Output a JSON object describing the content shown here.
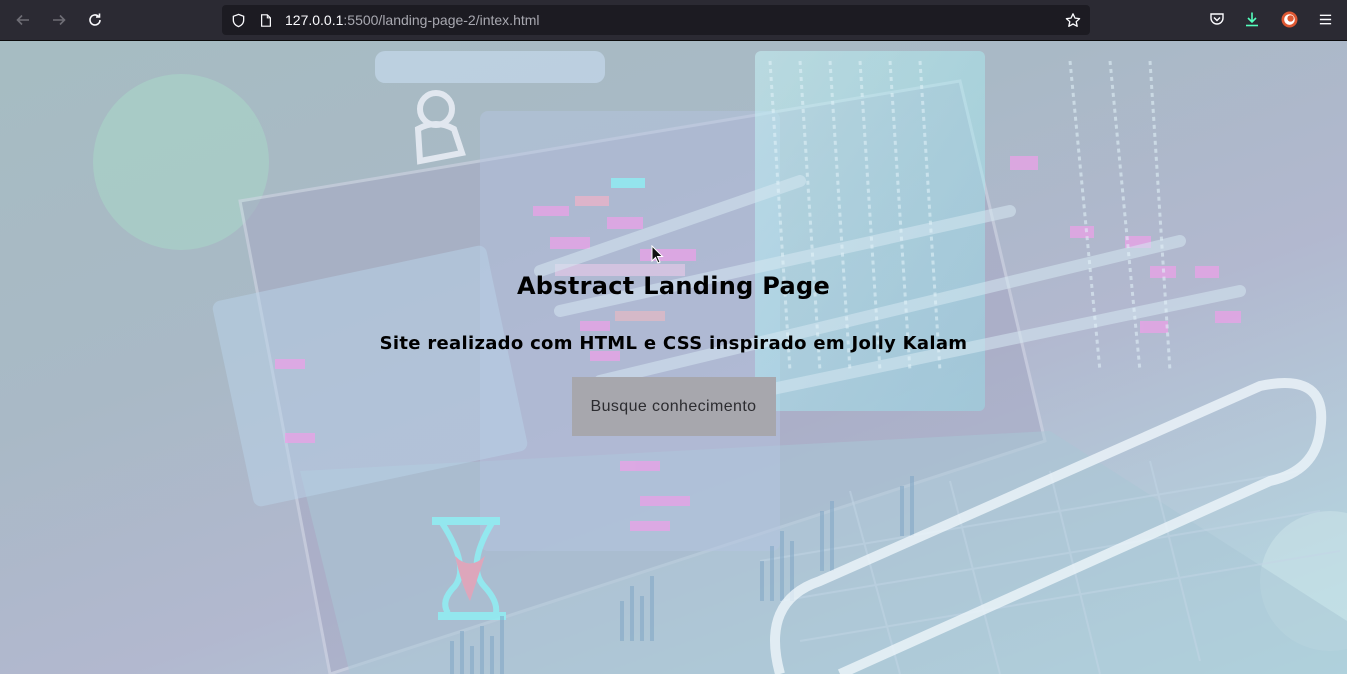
{
  "browser": {
    "url_host": "127.0.0.1",
    "url_rest": ":5500/landing-page-2/intex.html",
    "icons": {
      "back": "arrow-left-icon",
      "forward": "arrow-right-icon",
      "reload": "reload-icon",
      "shield": "tracking-protection-shield-icon",
      "page": "page-info-icon",
      "bookmark": "star-icon",
      "pocket": "pocket-icon",
      "downloads": "download-icon",
      "extension": "duckduckgo-extension-icon",
      "menu": "hamburger-menu-icon"
    }
  },
  "hero": {
    "title": "Abstract Landing Page",
    "subtitle": "Site realizado com HTML e CSS inspirado em Jolly Kalam",
    "button_label": "Busque conhecimento"
  },
  "colors": {
    "chrome_bg": "#2b2a33",
    "urlbar_bg": "#1c1b22",
    "button_bg": "#a7a7ad",
    "accent_pink": "#e7a3e6",
    "accent_cyan": "#8feff4"
  }
}
